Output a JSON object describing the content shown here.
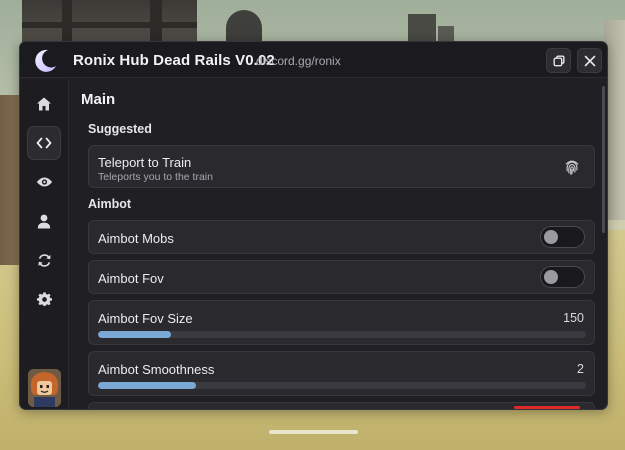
{
  "window": {
    "title": "Ronix Hub Dead Rails V0.02",
    "subtitle": "discord.gg/ronix"
  },
  "titlebar_buttons": [
    {
      "icon": "restore-icon"
    },
    {
      "icon": "close-icon"
    }
  ],
  "sidebar": {
    "items": [
      {
        "icon": "home-icon",
        "active": false
      },
      {
        "icon": "code-icon",
        "active": true
      },
      {
        "icon": "eye-icon",
        "active": false
      },
      {
        "icon": "user-icon",
        "active": false
      },
      {
        "icon": "refresh-icon",
        "active": false
      },
      {
        "icon": "gear-icon",
        "active": false
      }
    ],
    "avatar": "avatar"
  },
  "main": {
    "title": "Main",
    "sections": [
      {
        "label": "Suggested",
        "items": [
          {
            "type": "button",
            "title": "Teleport to Train",
            "desc": "Teleports you to the train",
            "icon": "fingerprint-icon"
          }
        ]
      },
      {
        "label": "Aimbot",
        "items": [
          {
            "type": "toggle",
            "title": "Aimbot Mobs",
            "on": false
          },
          {
            "type": "toggle",
            "title": "Aimbot Fov",
            "on": false
          },
          {
            "type": "slider",
            "title": "Aimbot Fov Size",
            "value": "150",
            "fill": 0.15
          },
          {
            "type": "slider",
            "title": "Aimbot Smoothness",
            "value": "2",
            "fill": 0.2
          }
        ]
      }
    ]
  },
  "colors": {
    "window_bg": "#202024",
    "card_bg": "#29292e",
    "accent": "#7aa9d6",
    "red_accent": "#e02a2a"
  }
}
